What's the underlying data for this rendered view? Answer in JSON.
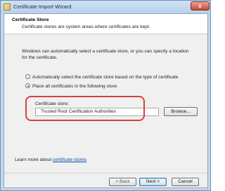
{
  "window": {
    "title": "Certificate Import Wizard",
    "close_glyph": "x"
  },
  "header": {
    "title": "Certificate Store",
    "subtitle": "Certificate stores are system areas where certificates are kept."
  },
  "intro": "Windows can automatically select a certificate store, or you can specify a location for the certificate.",
  "options": [
    {
      "label": "Automatically select the certificate store based on the type of certificate",
      "selected": false
    },
    {
      "label": "Place all certificates in the following store",
      "selected": true
    }
  ],
  "store": {
    "label": "Certificate store:",
    "value": "Trusted Root Certification Authorities",
    "browse_label": "Browse..."
  },
  "learn_more": {
    "prefix": "Learn more about",
    "link": "certificate stores"
  },
  "footer": {
    "back_label": "< Back",
    "next_label": "Next >",
    "cancel_label": "Cancel"
  },
  "colors": {
    "highlight": "#d6413a",
    "link": "#0a4ca8",
    "title_bar": "#c2d8ee"
  }
}
